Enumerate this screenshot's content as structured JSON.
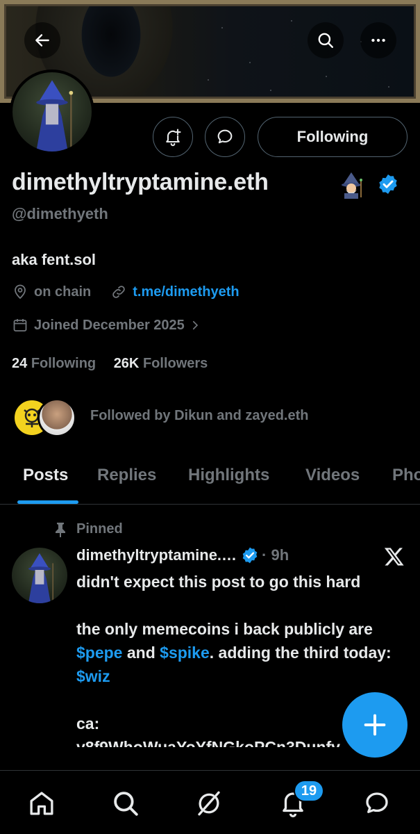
{
  "banner": {
    "back_icon": "arrow-left-icon",
    "search_icon": "search-icon",
    "more_icon": "more-horizontal-icon"
  },
  "profile": {
    "display_name": "dimethyltryptamine.eth",
    "name_emoji": "wizard-emoji",
    "verified_icon": "verified-badge-icon",
    "handle": "@dimethyeth",
    "bio": "aka fent.sol",
    "location": "on chain",
    "link": "t.me/dimethyeth",
    "joined": "Joined December 2025",
    "following_count": "24",
    "following_label": "Following",
    "followers_count": "26K",
    "followers_label": "Followers",
    "followed_by": "Followed by Dikun and zayed.eth"
  },
  "actions": {
    "notify_icon": "bell-plus-icon",
    "message_icon": "message-bubble-icon",
    "following_button": "Following"
  },
  "tabs": [
    {
      "label": "Posts",
      "active": true
    },
    {
      "label": "Replies",
      "active": false
    },
    {
      "label": "Highlights",
      "active": false
    },
    {
      "label": "Videos",
      "active": false
    },
    {
      "label": "Pho",
      "active": false
    }
  ],
  "post": {
    "pinned_label": "Pinned",
    "author": "dimethyltryptamine.…",
    "time": "· 9h",
    "line1": "didn't expect this post to go this hard",
    "line2_a": "the only memecoins i back publicly are ",
    "cashtag1": "$pepe",
    "line2_b": " and ",
    "cashtag2": "$spike",
    "line2_c": ". adding the third today: ",
    "cashtag3": "$wiz",
    "ca_label": "ca:",
    "ca_partial": "v8f9WhoWuaYoYfNGkoPCn3Dunfv"
  },
  "nav": {
    "home_icon": "home-icon",
    "search_icon": "search-icon",
    "grok_icon": "grok-icon",
    "notifications_icon": "bell-icon",
    "notifications_badge": "19",
    "messages_icon": "message-icon"
  },
  "colors": {
    "accent": "#1d9bf0",
    "background": "#000000",
    "muted_text": "#71767b",
    "primary_text": "#e7e9ea"
  }
}
